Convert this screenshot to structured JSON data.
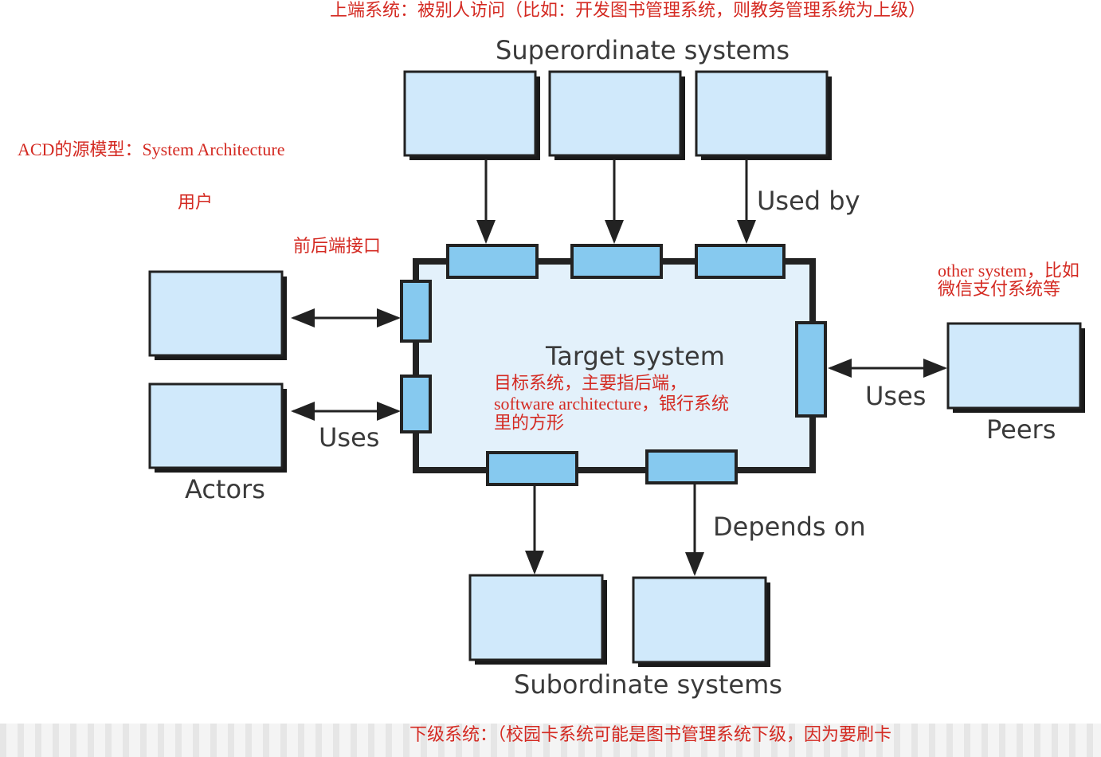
{
  "annotations": {
    "top": "上端系统：被别人访问（比如：开发图书管理系统，则教务管理系统为上级）",
    "acd": "ACD的源模型：System Architecture",
    "user": "用户",
    "interface": "前后端接口",
    "other_line1": "other system，比如",
    "other_line2": "微信支付系统等",
    "target_line1": "目标系统，主要指后端，",
    "target_line2": "software architecture，银行系统",
    "target_line3": "里的方形",
    "bottom": "下级系统：（校园卡系统可能是图书管理系统下级，因为要刷卡"
  },
  "diagram": {
    "superordinate": "Superordinate systems",
    "used_by": "Used by",
    "target": "Target system",
    "uses_left": "Uses",
    "actors": "Actors",
    "uses_right": "Uses",
    "peers": "Peers",
    "depends_on": "Depends on",
    "subordinate": "Subordinate systems"
  },
  "colors": {
    "box": "#d0e9fb",
    "port": "#86c9ef",
    "target": "#e3f1fb",
    "annotation": "#d42a22"
  }
}
